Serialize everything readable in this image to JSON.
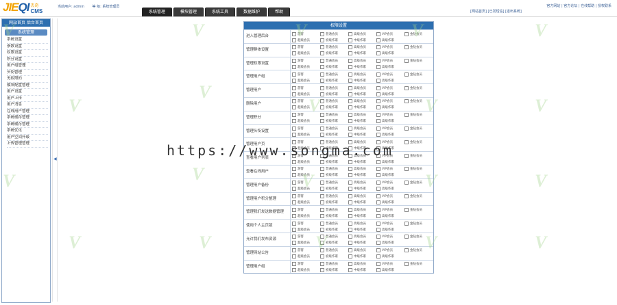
{
  "header": {
    "logo_main_a": "JIE",
    "logo_main_b": "QI",
    "logo_sub_cn": "杰奇",
    "logo_sub_cms": "CMS",
    "user_label": "当前用户: admin",
    "group_label": "等    级: 系统管理员",
    "tabs": [
      "系统管理",
      "模块管理",
      "系统工具",
      "数据维护",
      "帮助"
    ],
    "links_left": "[网站首页] [已发短信] [退出系统]",
    "links_right": "官方网站 | 官方论坛 | 在线帮助 | 授权联系"
  },
  "sidebar": {
    "home_tabs": "网站首页 后台首页",
    "category": "系统管理",
    "items": [
      "系统设置",
      "参数设置",
      "权限设置",
      "积分设置",
      "用户组管理",
      "头衔管理",
      "无权限的",
      "模块配置管理",
      "用户设置",
      "用户上传",
      "用户消息",
      "在线用户管理",
      "系统缓存管理",
      "系统缓存管理",
      "系统优化",
      "用户空间升级",
      "上传管理管理"
    ]
  },
  "panel": {
    "title": "权限设置",
    "option_labels": [
      "游客",
      "普通会员",
      "高级会员",
      "VIP会员",
      "金钻会员",
      "超级会员",
      "初级作家",
      "中级作家",
      "高级作家"
    ],
    "rows": [
      "进入管理后台",
      "管理群体设置",
      "管理权限设置",
      "管理用户组",
      "管理用户",
      "删除用户",
      "管理积分",
      "管理头衔设置",
      "管理用户页",
      "查看用户列表",
      "查看在线用户",
      "管理用户备份",
      "管理用户积分整理",
      "管理我们发送数据管理",
      "使用个人主页版",
      "允许我们发布资源",
      "管理网站公告",
      "管理用户组"
    ]
  },
  "overlay": {
    "url": "https://www.songma.com"
  },
  "watermark": {
    "text": "V"
  }
}
